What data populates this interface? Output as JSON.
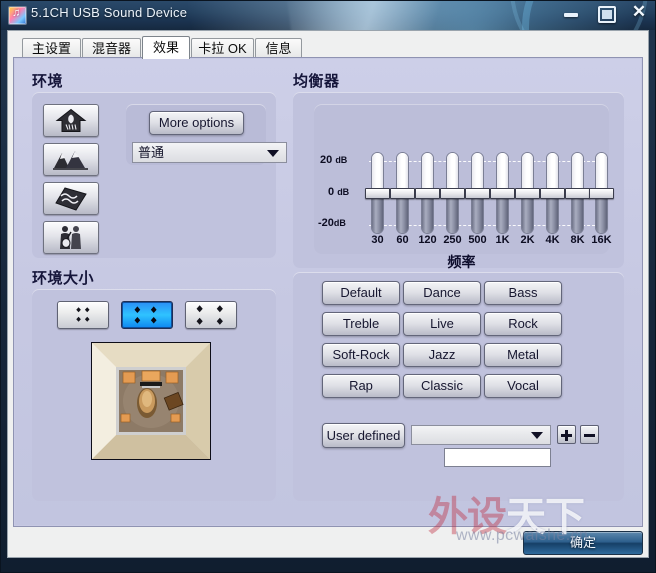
{
  "window": {
    "title": "5.1CH USB Sound Device",
    "icon": "sound-device-icon",
    "controls": {
      "minimize": "minimize-icon",
      "maximize": "maximize-icon",
      "close": "close-icon"
    }
  },
  "tabs": [
    {
      "label": "主设置",
      "selected": false
    },
    {
      "label": "混音器",
      "selected": false
    },
    {
      "label": "效果",
      "selected": true
    },
    {
      "label": "卡拉 OK",
      "selected": false
    },
    {
      "label": "信息",
      "selected": false
    }
  ],
  "environment": {
    "title": "环境",
    "more_options_label": "More options",
    "preset_value": "普通",
    "icon_buttons": [
      {
        "name": "env-icon-room",
        "icon": "house-icon"
      },
      {
        "name": "env-icon-mountain",
        "icon": "mountain-icon"
      },
      {
        "name": "env-icon-cave",
        "icon": "stone-plate-icon"
      },
      {
        "name": "env-icon-concert",
        "icon": "musicians-icon"
      }
    ]
  },
  "environment_size": {
    "title": "环境大小",
    "sizes": [
      {
        "name": "size-small",
        "icon": "small-room-icon",
        "selected": false
      },
      {
        "name": "size-medium",
        "icon": "medium-room-icon",
        "selected": true
      },
      {
        "name": "size-large",
        "icon": "large-room-icon",
        "selected": false
      }
    ],
    "preview_name": "room-preview-image"
  },
  "equalizer": {
    "title": "均衡器",
    "axis": {
      "top_label": "20",
      "top_unit": "dB",
      "mid_label": "0",
      "mid_unit": "dB",
      "bot_label": "-20",
      "bot_unit": "dB"
    },
    "frequency_title": "频率",
    "bands": [
      {
        "label": "30",
        "value": 0
      },
      {
        "label": "60",
        "value": 0
      },
      {
        "label": "120",
        "value": 0
      },
      {
        "label": "250",
        "value": 0
      },
      {
        "label": "500",
        "value": 0
      },
      {
        "label": "1K",
        "value": 0
      },
      {
        "label": "2K",
        "value": 0
      },
      {
        "label": "4K",
        "value": 0
      },
      {
        "label": "8K",
        "value": 0
      },
      {
        "label": "16K",
        "value": 0
      }
    ],
    "presets": [
      "Default",
      "Dance",
      "Bass",
      "Treble",
      "Live",
      "Rock",
      "Soft-Rock",
      "Jazz",
      "Metal",
      "Rap",
      "Classic",
      "Vocal"
    ],
    "user_defined": {
      "button_label": "User defined",
      "combo_value": "",
      "add_label": "+",
      "remove_label": "−",
      "name_input_value": "",
      "name_input_placeholder": ""
    }
  },
  "footer": {
    "ok_label": "确定"
  },
  "watermark": {
    "text_red": "外设",
    "text_white": "天下",
    "url": "www.pcwaishe.cn"
  },
  "chart_data": {
    "type": "bar",
    "title": "均衡器",
    "xlabel": "频率",
    "ylabel": "dB",
    "categories": [
      "30",
      "60",
      "120",
      "250",
      "500",
      "1K",
      "2K",
      "4K",
      "8K",
      "16K"
    ],
    "values": [
      0,
      0,
      0,
      0,
      0,
      0,
      0,
      0,
      0,
      0
    ],
    "ylim": [
      -20,
      20
    ],
    "yticks": [
      -20,
      0,
      20
    ],
    "grid": true,
    "legend": "none"
  }
}
